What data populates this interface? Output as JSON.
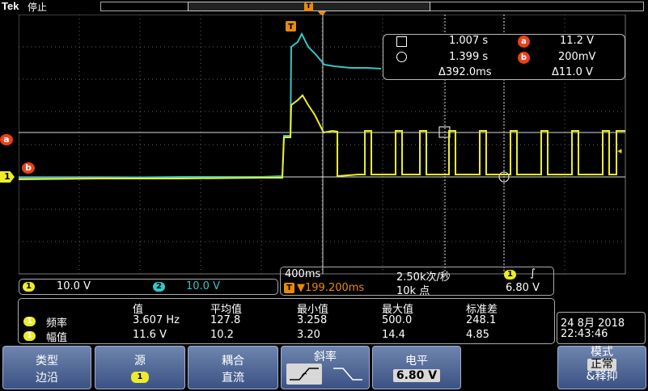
{
  "header": {
    "brand": "Tek",
    "run_state": "停止",
    "trigger_pos_marker": "T"
  },
  "markers": {
    "ch1": "1",
    "a": "a",
    "b": "b",
    "trigger_top": "T"
  },
  "cursor_readout": {
    "t1": "1.007 s",
    "t2": "1.399 s",
    "a_value": "11.2 V",
    "b_value": "200mV",
    "delta_t": "Δ392.0ms",
    "delta_v": "Δ11.0 V",
    "a_label": "a",
    "b_label": "b"
  },
  "channels": {
    "ch1_badge": "1",
    "ch1_scale": "10.0 V",
    "ch1_color": "#ecec2a",
    "ch2_badge": "2",
    "ch2_scale": "10.0 V",
    "ch2_color": "#35c6c6"
  },
  "horizontal": {
    "timebase": "400ms",
    "sample_rate": "2.50k次/秒",
    "trig_badge": "1",
    "trig_slope": "∫",
    "trig_delay": "▼199.200ms",
    "record_length": "10k 点",
    "trig_level": "6.80 V",
    "trig_icon": "T"
  },
  "measurements": {
    "headers": [
      "值",
      "平均值",
      "最小值",
      "最大值",
      "标准差"
    ],
    "rows": [
      {
        "badge": "1",
        "name": "频率",
        "values": [
          "3.607 Hz",
          "127.8",
          "3.258",
          "500.0",
          "248.1"
        ]
      },
      {
        "badge": "1",
        "name": "幅值",
        "values": [
          "11.6 V",
          "10.2",
          "3.20",
          "14.4",
          "4.85"
        ]
      }
    ]
  },
  "datetime": {
    "date": "24 8月 2018",
    "time": "22:43:46"
  },
  "menu": {
    "type_label": "类型",
    "type_value": "边沿",
    "source_label": "源",
    "source_value": "1",
    "coupling_label": "耦合",
    "coupling_value": "直流",
    "slope_label": "斜率",
    "level_label": "电平",
    "level_value": "6.80 V",
    "mode_label": "模式",
    "mode_value1": "正常",
    "mode_value2": "&释抑"
  },
  "colors": {
    "ch1": "#ecec2a",
    "ch2": "#35c6c6",
    "marker": "#e8421a",
    "trigger": "#e98a0c",
    "menu": "#4e6799"
  }
}
